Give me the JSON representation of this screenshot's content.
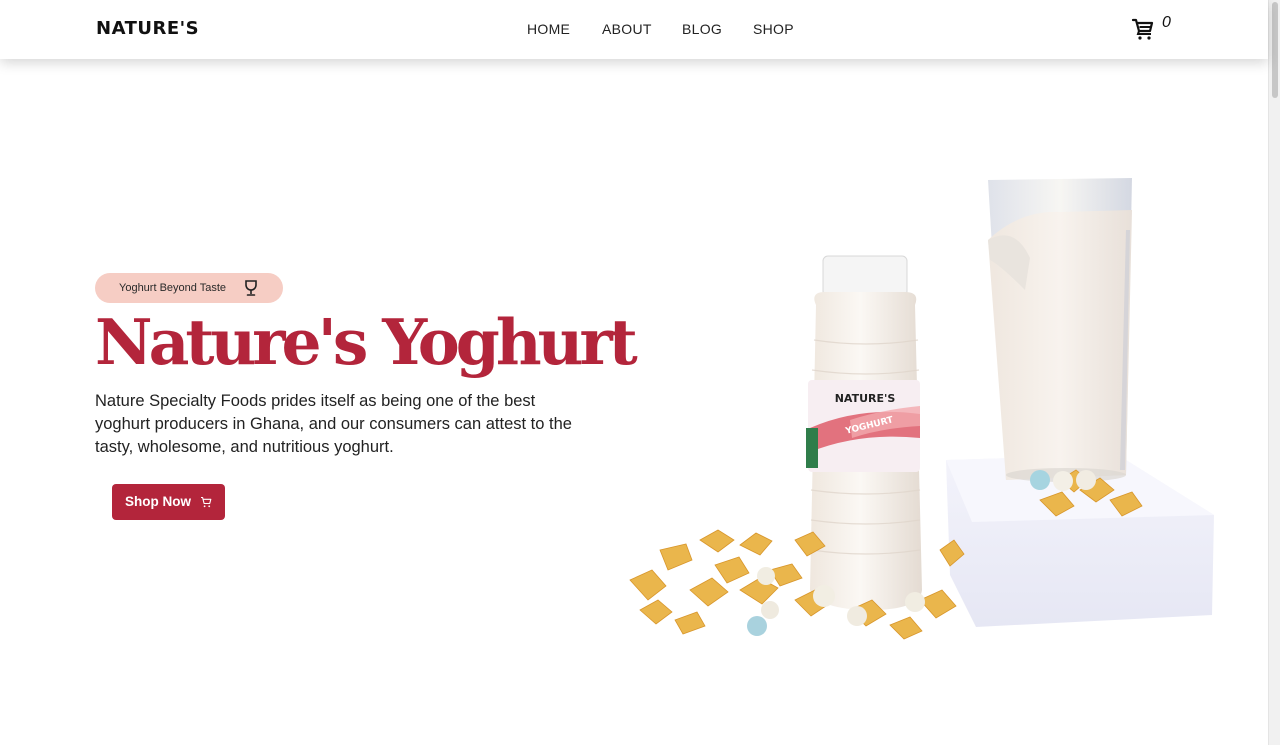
{
  "header": {
    "logo": "NATURE'S",
    "nav": [
      {
        "label": "HOME"
      },
      {
        "label": "ABOUT"
      },
      {
        "label": "BLOG"
      },
      {
        "label": "SHOP"
      }
    ],
    "cart_icon": "cart-icon",
    "cart_count": "0"
  },
  "hero": {
    "badge_text": "Yoghurt Beyond Taste",
    "badge_icon": "trophy-icon",
    "title": "Nature's Yoghurt",
    "description": "Nature Specialty Foods prides itself as being one of the best yoghurt producers in Ghana, and our consumers can attest to the tasty, wholesome, and nutritious yoghurt.",
    "button_label": "Shop Now",
    "button_icon": "cart-icon"
  },
  "product_image": {
    "bottle_brand": "NATURE'S",
    "bottle_label": "YOGHURT"
  },
  "colors": {
    "accent": "#b3253b",
    "badge_bg": "#f6cdc4"
  }
}
